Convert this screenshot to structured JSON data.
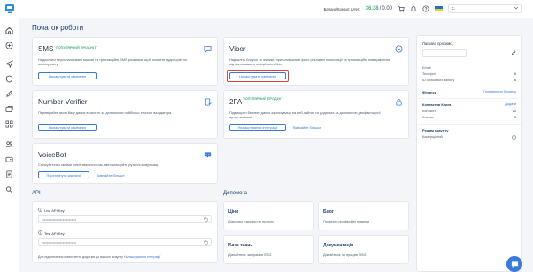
{
  "topbar": {
    "balance_label": "Баланс/Кредит, UAH:",
    "balance_value": "36.38",
    "balance_sep": "/",
    "credit_value": "0.00",
    "user_prefix": "с."
  },
  "page_title": "Початок роботи",
  "cards": {
    "sms": {
      "title": "SMS",
      "badge": "ПОПУЛЯРНИЙ ПРОДУКТ",
      "desc": "Надсилати персоналізовані масові та транзакційні SMS розсилки, щоб охопити аудиторію по всьому світу",
      "button": "Налаштувати кампанію"
    },
    "viber": {
      "title": "Viber",
      "desc": "Надішліть бонуси та знижки, приголомшливі фото рекламні пропозиції та транзакційні повідомлення від імені вашого офіційного Viber",
      "button": "Налаштувати кампанію"
    },
    "number_verifier": {
      "title": "Number Verifier",
      "desc": "Перевіряйте свою базу даних в чистоті за допомогою найбільш точного валідатора.",
      "button": "Налаштувати кампанію"
    },
    "twofa": {
      "title": "2FA",
      "badge": "ПОПУЛЯРНИЙ ПРОДУКТ",
      "desc": "Підвищити безпеку даних користувача на веб-сайтах та додатках за допомогою двофакторної аутентифікації",
      "button": "Налаштування інтеграції",
      "link": "Вивчайте більше"
    },
    "voicebot": {
      "title": "VoiceBot",
      "desc": "Спілкуйтеся з своїми клієнтами голосом, автоматизуйте рутинні комунікації.",
      "button": "Переглянути кампанії",
      "link": "Вивчайте більше"
    }
  },
  "api": {
    "section_title": "API",
    "live_label": "Live API Key",
    "live_value": "••••••••••••••••••••••••••••",
    "test_label": "Test API Key",
    "test_value": "••••••••••••••••••••••••••••",
    "note_prefix": "Для підключення компонента додатків до вашого акаунту",
    "note_link": "Налаштування інтеграції"
  },
  "help": {
    "section_title": "Допомога",
    "items": [
      {
        "title": "Ціни",
        "desc": "Дізнатися тарифи на послуги"
      },
      {
        "title": "Блог",
        "desc": "Почитати професійні новинки"
      },
      {
        "title": "База знань",
        "desc": "Дізнайтеся, як працює BSG"
      },
      {
        "title": "Документація",
        "desc": "Дізнайтеся, як працює BSG"
      }
    ]
  },
  "right_panel": {
    "greeting": "Ласкаво просимо,",
    "rows": [
      {
        "label": "Email",
        "value": ""
      },
      {
        "label": "Телефон",
        "value": "6"
      },
      {
        "label": "ID облікового запису",
        "value": "6"
      }
    ],
    "finance_title": "Фінанси",
    "finance_link": "Поповнення балансу",
    "contacts_title": "Контактна Книга",
    "contacts_link": "Додати",
    "contacts_rows": [
      {
        "label": "Контакти",
        "value": "20"
      },
      {
        "label": "Списки",
        "value": "5"
      }
    ],
    "mode_title": "Режим акаунту",
    "mode_label": "Комерційний"
  },
  "colors": {
    "accent": "#3979d8",
    "success": "#4caf7d",
    "highlight": "#e0413b",
    "title": "#1c3f72"
  }
}
